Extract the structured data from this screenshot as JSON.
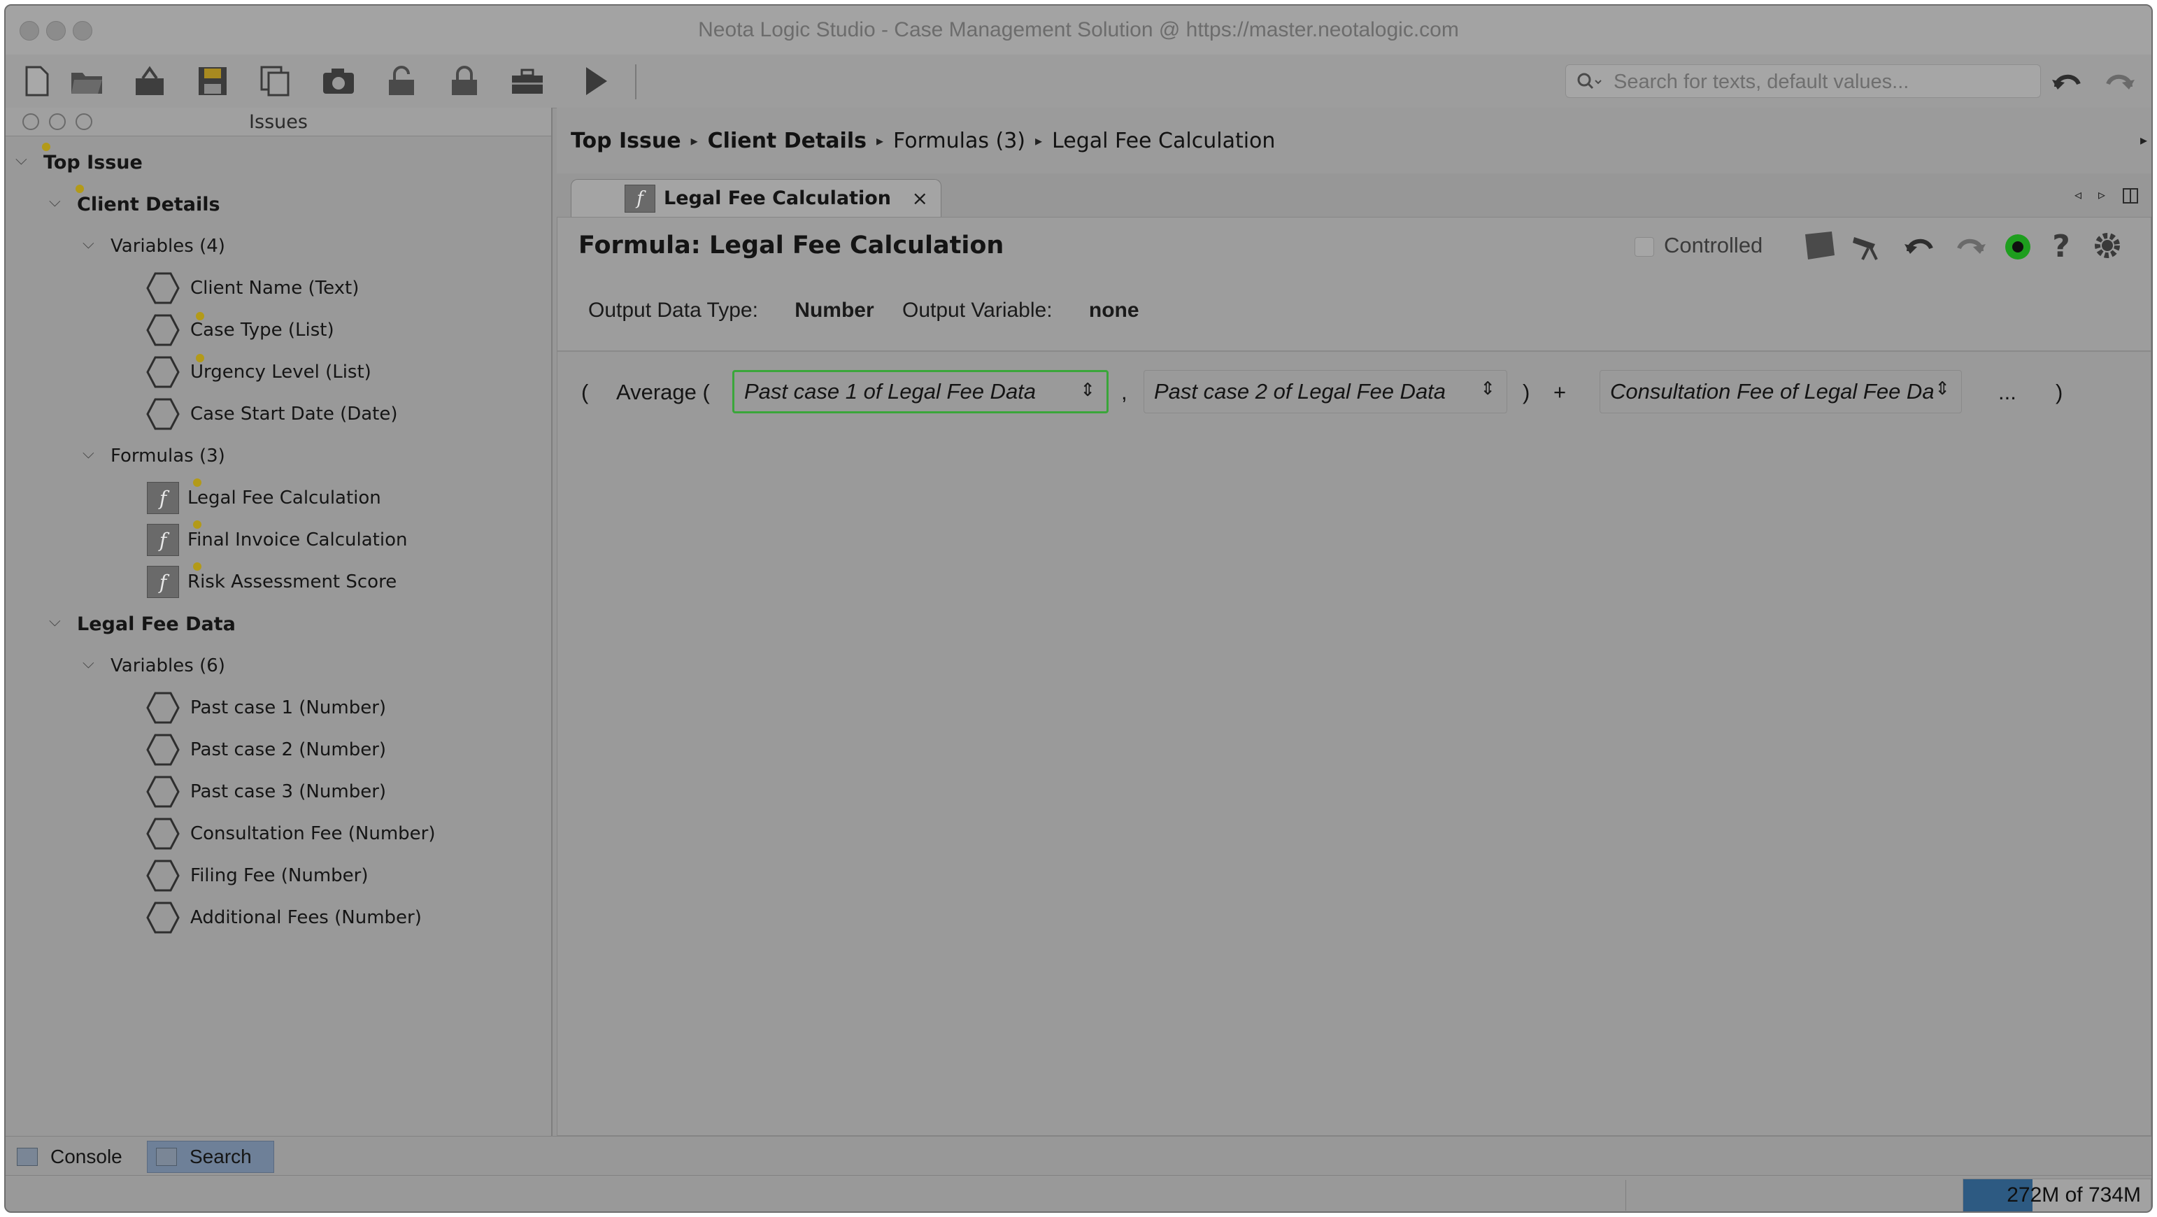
{
  "window": {
    "title": "Neota Logic Studio - Case Management Solution @ https://master.neotalogic.com"
  },
  "toolbar": {
    "icons": [
      "new-file-icon",
      "open-folder-icon",
      "open-package-icon",
      "save-icon",
      "copy-icon",
      "camera-icon",
      "lock-open-icon",
      "lock-closed-icon",
      "toolbox-icon",
      "play-icon"
    ],
    "search_placeholder": "Search for texts, default values...",
    "search_icon": "magnifier-icon"
  },
  "issues_panel": {
    "title": "Issues",
    "tree": {
      "top_issue": "Top Issue",
      "client_details": "Client Details",
      "cd_variables": "Variables (4)",
      "client_name": "Client Name (Text)",
      "case_type": "Case Type (List)",
      "urgency_level": "Urgency Level (List)",
      "case_start_date": "Case Start Date (Date)",
      "cd_formulas": "Formulas (3)",
      "legal_fee_calc": "Legal Fee Calculation",
      "final_invoice_calc": "Final Invoice Calculation",
      "risk_assessment": "Risk Assessment Score",
      "legal_fee_data": "Legal Fee Data",
      "lfd_variables": "Variables (6)",
      "past_case_1": "Past case 1 (Number)",
      "past_case_2": "Past case 2 (Number)",
      "past_case_3": "Past case 3 (Number)",
      "consultation_fee": "Consultation Fee (Number)",
      "filing_fee": "Filing Fee (Number)",
      "additional_fees": "Additional Fees (Number)"
    }
  },
  "breadcrumb": {
    "items": [
      "Top Issue",
      "Client Details",
      "Formulas (3)",
      "Legal Fee Calculation"
    ],
    "separator": "▸"
  },
  "tab": {
    "label": "Legal Fee Calculation",
    "close": "×"
  },
  "formula": {
    "title": "Formula:  Legal Fee Calculation",
    "controlled_label": "Controlled",
    "output_type_label": "Output Data Type:",
    "output_type_value": "Number",
    "output_variable_label": "Output Variable:",
    "output_variable_value": "none",
    "header_icons": [
      "sticky-note-icon",
      "telescope-icon",
      "undo-icon",
      "redo-icon",
      "status-green-icon",
      "help-icon",
      "gear-icon"
    ],
    "status_color": "#1e9e1e",
    "expression": {
      "open_paren": "(",
      "function": "Average (",
      "arg1": "Past case 1 of Legal Fee Data",
      "comma": ",",
      "arg2": "Past case 2 of Legal Fee Data",
      "close_paren": ")",
      "plus": "+",
      "arg3": "Consultation Fee of Legal Fee Data",
      "ellipsis": "...",
      "end_paren": ")",
      "selected_border_color": "#3aa63a"
    }
  },
  "bottom_tabs": {
    "console": "Console",
    "search": "Search"
  },
  "status": {
    "memory_text": "272M of 734M",
    "memory_used_fraction": 0.37
  }
}
